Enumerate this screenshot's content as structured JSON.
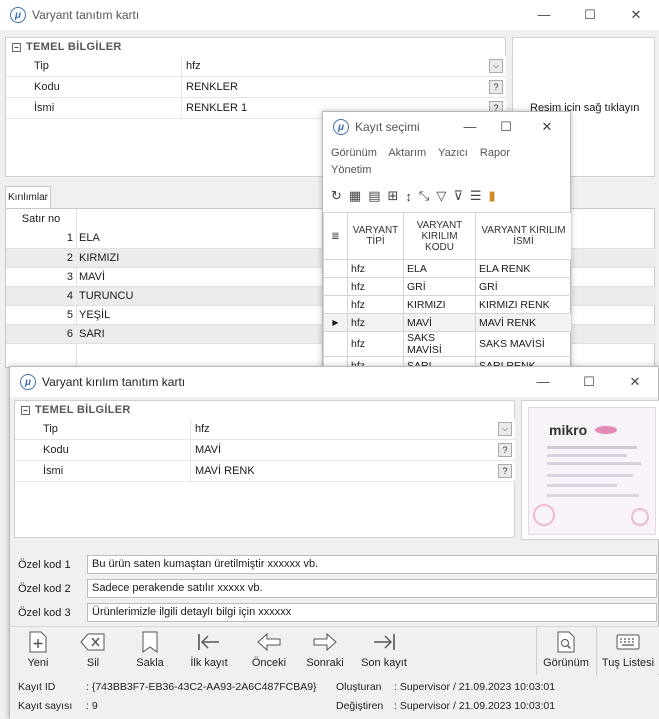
{
  "main_window": {
    "title": "Varyant tanıtım kartı",
    "section": "TEMEL BİLGİLER",
    "fields": [
      {
        "label": "Tip",
        "value": "hfz"
      },
      {
        "label": "Kodu",
        "value": "RENKLER"
      },
      {
        "label": "İsmi",
        "value": "RENKLER 1"
      }
    ],
    "image_hint": "Resim için sağ tıklayın",
    "tab": "Kırılımlar",
    "grid_header": "Satır no",
    "rows": [
      {
        "no": "1",
        "name": "ELA"
      },
      {
        "no": "2",
        "name": "KIRMIZI"
      },
      {
        "no": "3",
        "name": "MAVİ"
      },
      {
        "no": "4",
        "name": "TURUNCU"
      },
      {
        "no": "5",
        "name": "YEŞİL"
      },
      {
        "no": "6",
        "name": "SARI"
      }
    ]
  },
  "kayit_dialog": {
    "title": "Kayıt seçimi",
    "menu": [
      "Görünüm",
      "Aktarım",
      "Yazıcı",
      "Rapor",
      "Yönetim"
    ],
    "columns": [
      "VARYANT TİPİ",
      "VARYANT KIRILIM KODU",
      "VARYANT KIRILIM İSMİ"
    ],
    "rows": [
      {
        "tip": "hfz",
        "kod": "ELA",
        "isim": "ELA RENK",
        "current": false
      },
      {
        "tip": "hfz",
        "kod": "GRİ",
        "isim": "GRİ",
        "current": false
      },
      {
        "tip": "hfz",
        "kod": "KIRMIZI",
        "isim": "KIRMIZI RENK",
        "current": false
      },
      {
        "tip": "hfz",
        "kod": "MAVİ",
        "isim": "MAVİ RENK",
        "current": true
      },
      {
        "tip": "hfz",
        "kod": "SAKS MAVİSİ",
        "isim": "SAKS MAVİSİ",
        "current": false
      },
      {
        "tip": "hfz",
        "kod": "SARI",
        "isim": "SARI RENK",
        "current": false
      }
    ]
  },
  "kirilim_window": {
    "title": "Varyant kırılım tanıtım kartı",
    "section": "TEMEL BİLGİLER",
    "fields": [
      {
        "label": "Tip",
        "value": "hfz"
      },
      {
        "label": "Kodu",
        "value": "MAVİ"
      },
      {
        "label": "İsmi",
        "value": "MAVİ RENK"
      }
    ],
    "thumb_brand": "mikro"
  },
  "ozel_kodlar": [
    {
      "label": "Özel kod 1",
      "value": "Bu ürün saten kumaştan üretilmiştir xxxxxx vb."
    },
    {
      "label": "Özel kod 2",
      "value": "Sadece perakende satılır xxxxx vb."
    },
    {
      "label": "Özel kod 3",
      "value": "Ürünlerimizle ilgili detaylı bilgi için xxxxxx"
    }
  ],
  "toolbar": {
    "yeni": "Yeni",
    "sil": "Sil",
    "sakla": "Sakla",
    "ilk_kayit": "İlk kayıt",
    "onceki": "Önceki",
    "sonraki": "Sonraki",
    "son_kayit": "Son kayıt",
    "gorunum": "Görünüm",
    "tus_listesi": "Tuş Listesi"
  },
  "status": {
    "kayit_id_label": "Kayıt ID",
    "kayit_id": ": {743BB3F7-EB36-43C2-AA93-2A6C487FCBA9}",
    "kayit_sayisi_label": "Kayıt sayısı",
    "kayit_sayisi": ": 9",
    "olusturan_label": "Oluşturan",
    "olusturan": ": Supervisor / 21.09.2023 10:03:01",
    "degistiren_label": "Değiştiren",
    "degistiren": ": Supervisor / 21.09.2023 10:03:01"
  },
  "colors": {
    "accent": "#3b6fb6",
    "selected_row": "#ececec"
  }
}
